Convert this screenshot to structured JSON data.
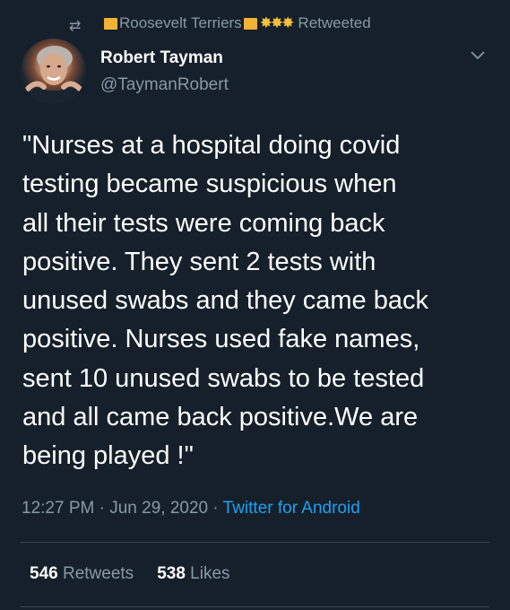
{
  "retweet": {
    "icon": "retweet-icon",
    "user": "Roosevelt Terriers",
    "suns": "✸✸✸",
    "label": "Retweeted"
  },
  "author": {
    "name": "Robert Tayman",
    "handle": "@TaymanRobert",
    "avatar_icon": "avatar"
  },
  "tweet": {
    "text": "\"Nurses at a hospital doing covid\ntesting became suspicious when\nall their tests were coming back\npositive. They sent 2 tests with\nunused swabs and they came back\npositive. Nurses used fake names,\nsent 10 unused swabs to be tested\nand all came back positive.We are\nbeing played !\"",
    "time": "12:27 PM",
    "separator": "·",
    "date": "Jun 29, 2020",
    "source": "Twitter for Android"
  },
  "stats": {
    "retweets_count": "546",
    "retweets_label": "Retweets",
    "likes_count": "538",
    "likes_label": "Likes"
  },
  "colors": {
    "background": "#15202b",
    "secondary_text": "#8899a6",
    "link": "#1da1f2",
    "divider": "#38444d"
  }
}
